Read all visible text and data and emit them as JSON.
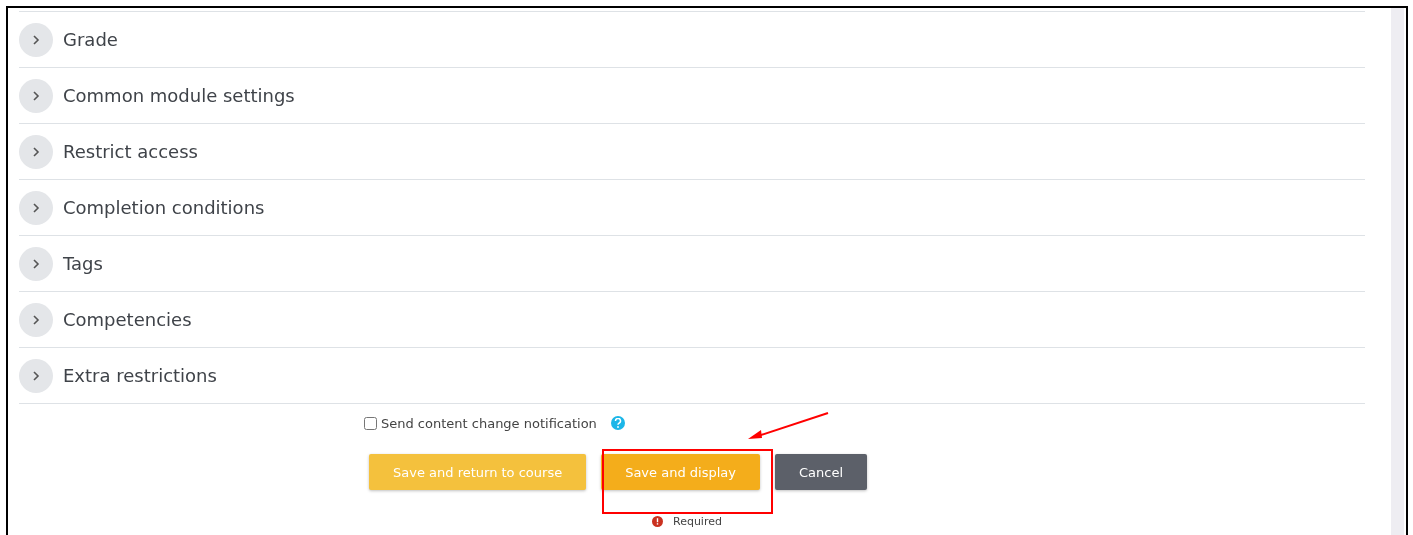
{
  "sections": [
    {
      "title": "Grade",
      "expanded": false
    },
    {
      "title": "Common module settings",
      "expanded": false
    },
    {
      "title": "Restrict access",
      "expanded": false
    },
    {
      "title": "Completion conditions",
      "expanded": false
    },
    {
      "title": "Tags",
      "expanded": false
    },
    {
      "title": "Competencies",
      "expanded": false
    },
    {
      "title": "Extra restrictions",
      "expanded": false
    }
  ],
  "notification": {
    "label": "Send content change notification",
    "checked": false
  },
  "buttons": [
    {
      "label": "Save and return to course",
      "kind": "secondary"
    },
    {
      "label": "Save and display",
      "kind": "primary"
    },
    {
      "label": "Cancel",
      "kind": "cancel"
    }
  ],
  "required_note": "Required"
}
